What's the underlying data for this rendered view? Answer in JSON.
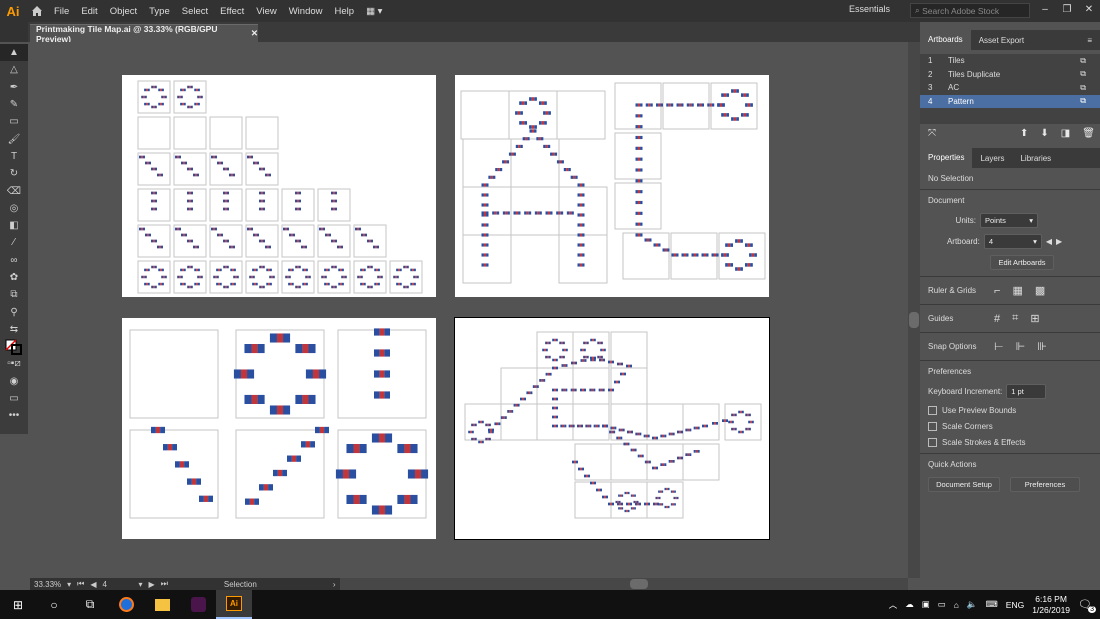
{
  "app": {
    "logo": "Ai"
  },
  "menu": [
    "File",
    "Edit",
    "Object",
    "Type",
    "Select",
    "Effect",
    "View",
    "Window",
    "Help"
  ],
  "workspace": "Essentials",
  "search": {
    "placeholder": "Search Adobe Stock"
  },
  "document_tab": "Printmaking Tile Map.ai @ 33.33% (RGB/GPU Preview)",
  "status": {
    "zoom": "33.33%",
    "artboard": "4",
    "tool": "Selection"
  },
  "artboards_panel": {
    "tabs": [
      "Artboards",
      "Asset Export"
    ],
    "items": [
      {
        "num": "1",
        "name": "Tiles"
      },
      {
        "num": "2",
        "name": "Tiles Duplicate"
      },
      {
        "num": "3",
        "name": "AC"
      },
      {
        "num": "4",
        "name": "Pattern"
      }
    ]
  },
  "properties": {
    "tabs": [
      "Properties",
      "Layers",
      "Libraries"
    ],
    "selection": "No Selection",
    "document_label": "Document",
    "units_label": "Units:",
    "units_value": "Points",
    "artboard_label": "Artboard:",
    "artboard_value": "4",
    "edit_artboards": "Edit Artboards",
    "ruler_grids": "Ruler & Grids",
    "guides": "Guides",
    "snap_options": "Snap Options",
    "preferences_label": "Preferences",
    "keyboard_increment_label": "Keyboard Increment:",
    "keyboard_increment_value": "1 pt",
    "use_preview_bounds": "Use Preview Bounds",
    "scale_corners": "Scale Corners",
    "scale_strokes": "Scale Strokes & Effects",
    "quick_actions": "Quick Actions",
    "document_setup": "Document Setup",
    "preferences_btn": "Preferences"
  },
  "taskbar": {
    "lang": "ENG",
    "time": "6:16 PM",
    "date": "1/26/2019",
    "notifications": "3"
  },
  "colors": {
    "accent_selected": "#4b6fa3",
    "tile_blue": "#2b4fa0",
    "tile_red": "#c0363a"
  }
}
